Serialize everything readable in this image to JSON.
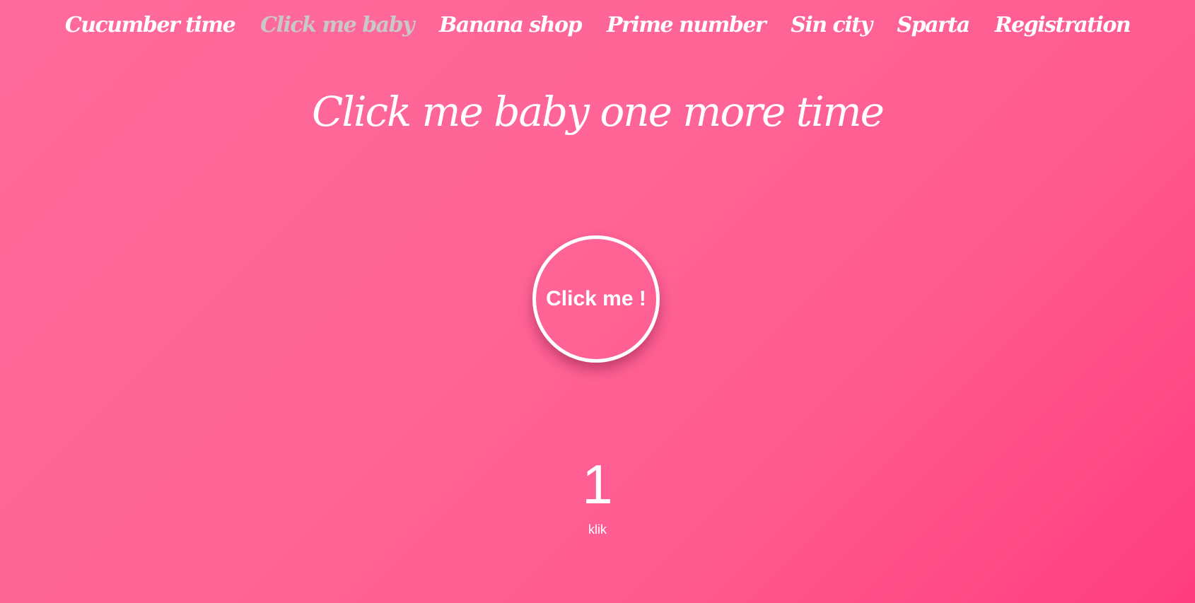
{
  "nav": {
    "items": [
      {
        "label": "Cucumber time"
      },
      {
        "label": "Click me baby",
        "active": true
      },
      {
        "label": "Banana shop"
      },
      {
        "label": "Prime number"
      },
      {
        "label": "Sin city"
      },
      {
        "label": "Sparta"
      },
      {
        "label": "Registration"
      }
    ]
  },
  "main": {
    "title": "Click me baby one more time",
    "button_label": "Click me !",
    "counter_value": "1",
    "counter_label": "klik"
  },
  "colors": {
    "background_start": "#ff6b9c",
    "background_end": "#ff3d7f",
    "text": "#ffffff",
    "nav_active": "#c8c8c8"
  }
}
